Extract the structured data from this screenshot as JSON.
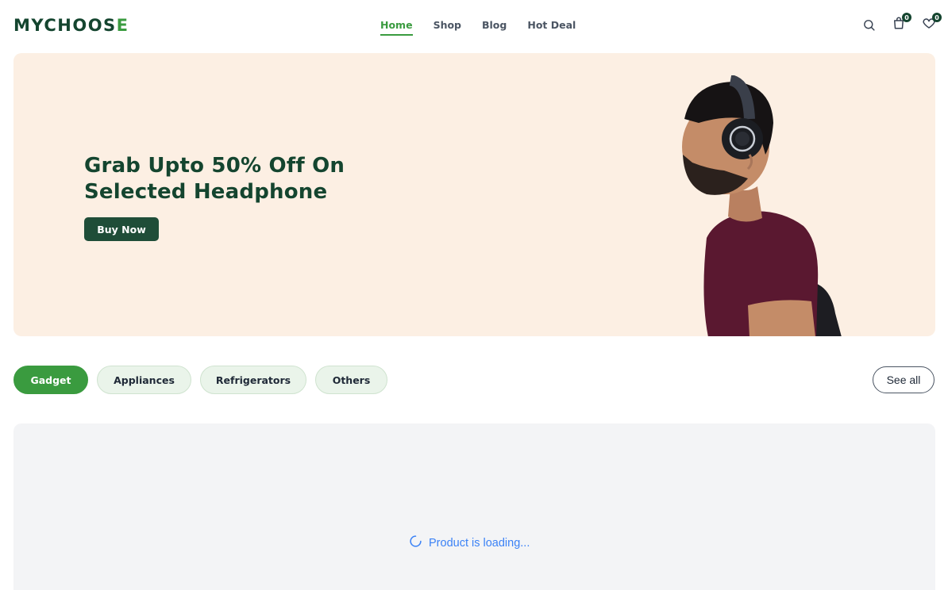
{
  "header": {
    "logo_main": "MYCHOOS",
    "logo_accent": "E",
    "nav": [
      {
        "label": "Home",
        "active": true
      },
      {
        "label": "Shop",
        "active": false
      },
      {
        "label": "Blog",
        "active": false
      },
      {
        "label": "Hot Deal",
        "active": false
      }
    ],
    "icons": {
      "search": "search-icon",
      "cart": "shopping-bag-icon",
      "cart_count": "0",
      "wishlist": "heart-icon",
      "wishlist_count": "0"
    }
  },
  "hero": {
    "title_line1": "Grab Upto 50% Off On",
    "title_line2": "Selected Headphone",
    "button_label": "Buy Now",
    "image": "man-with-headphones-image",
    "background": "#fcefe3"
  },
  "categories": {
    "tabs": [
      {
        "label": "Gadget",
        "active": true
      },
      {
        "label": "Appliances",
        "active": false
      },
      {
        "label": "Refrigerators",
        "active": false
      },
      {
        "label": "Others",
        "active": false
      }
    ],
    "see_all_label": "See all"
  },
  "products": {
    "loading_text": "Product is loading..."
  },
  "colors": {
    "brand_dark": "#14452f",
    "brand_green": "#3a9b3f",
    "loading_blue": "#3b82f6"
  }
}
